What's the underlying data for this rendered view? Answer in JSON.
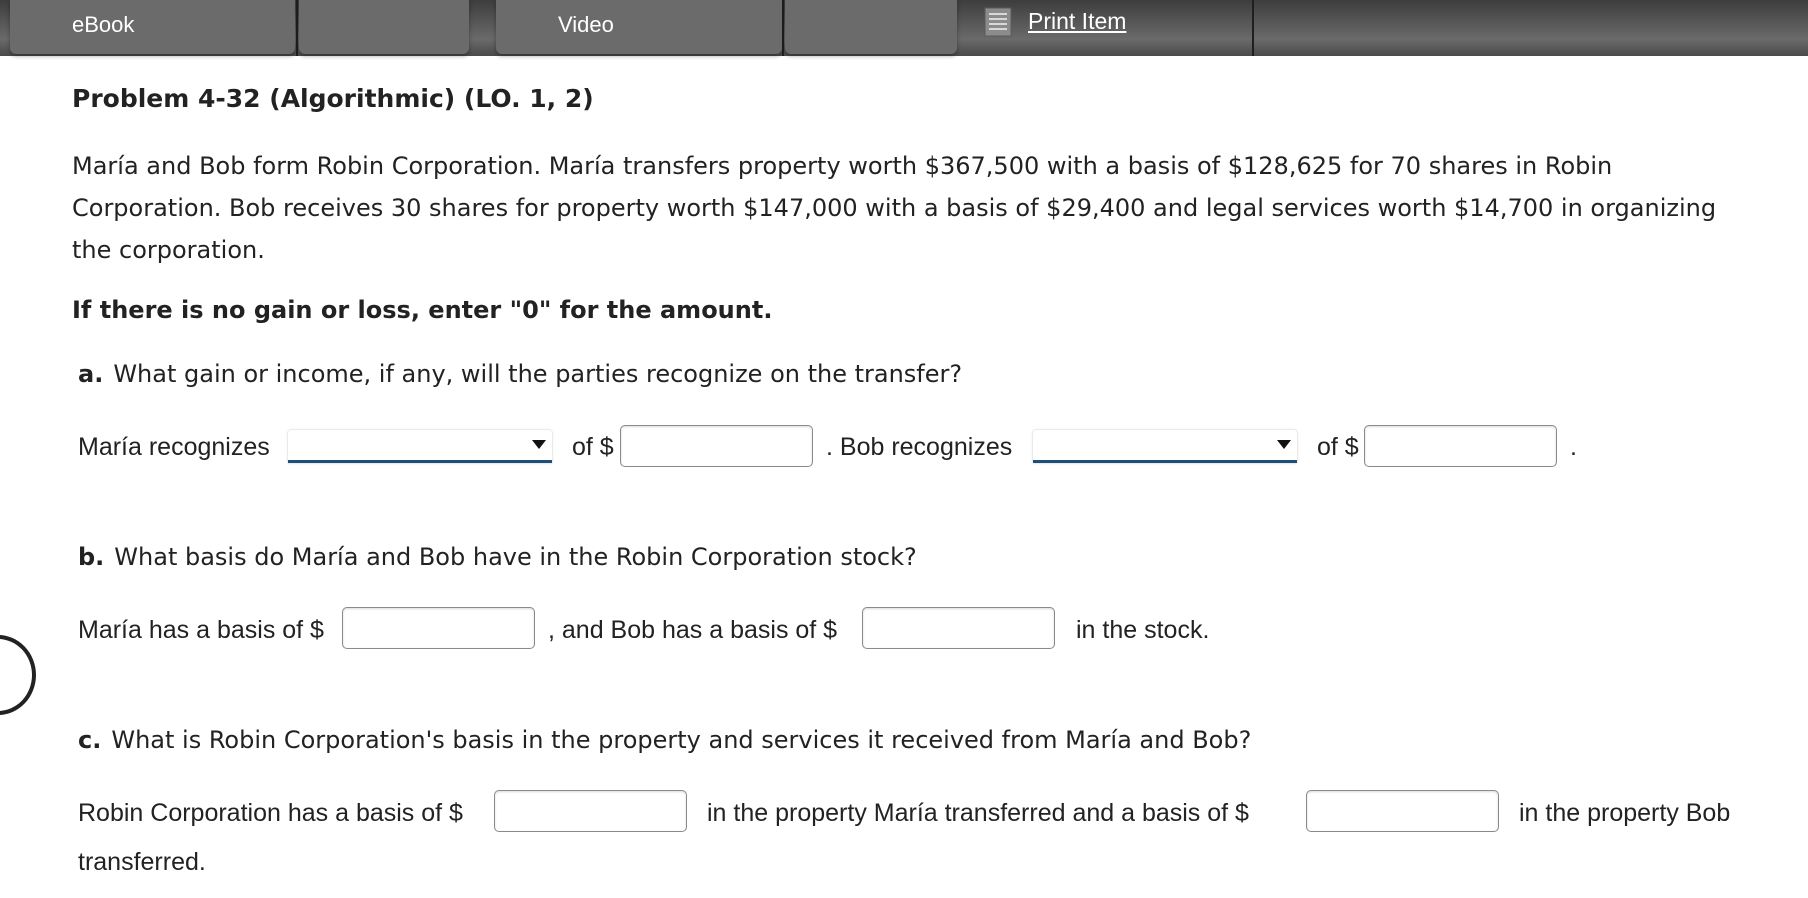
{
  "toolbar": {
    "ebook_label": "eBook",
    "video_label": "Video",
    "print_label": "Print Item",
    "print_icon": "document-icon"
  },
  "problem": {
    "title": "Problem 4-32 (Algorithmic) (LO. 1, 2)",
    "description": "María and Bob form Robin Corporation. María transfers property worth $367,500 with a basis of $128,625 for 70 shares in Robin Corporation. Bob receives 30 shares for property worth $147,000 with a basis of $29,400 and legal services worth $14,700 in organizing the corporation.",
    "instruction": "If there is no gain or loss, enter \"0\" for the amount."
  },
  "part_a": {
    "letter": "a.",
    "question": "What gain or income, if any, will the parties recognize on the transfer?",
    "maria_label": "María recognizes",
    "maria_select_value": "",
    "of_label_1": "of $",
    "maria_amount": "",
    "bob_label": ". Bob recognizes",
    "bob_select_value": "",
    "of_label_2": "of $",
    "bob_amount": "",
    "end_period": "."
  },
  "part_b": {
    "letter": "b.",
    "question": "What basis do María and Bob have in the Robin Corporation stock?",
    "maria_label": "María has a basis of $",
    "maria_value": "",
    "bob_label": ", and Bob has a basis of $",
    "bob_value": "",
    "suffix": "in the stock."
  },
  "part_c": {
    "letter": "c.",
    "question": "What is Robin Corporation's basis in the property and services it received from María and Bob?",
    "label_1": "Robin Corporation has a basis of $",
    "maria_property_value": "",
    "label_2": "in the property María transferred and a basis of $",
    "bob_property_value": "",
    "label_3": "in the property Bob",
    "label_4": "transferred."
  }
}
